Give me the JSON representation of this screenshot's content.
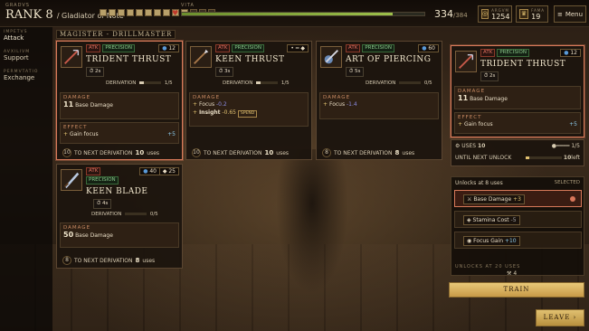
{
  "topbar": {
    "rank_label_small": "GRADVS",
    "rank_label": "RANK 8",
    "rank_title": "/ Gladiator of Note",
    "rank_pips": [
      true,
      true,
      true,
      true,
      true,
      true,
      true,
      true,
      true,
      true,
      false,
      false,
      false
    ],
    "vita_label": "VITA",
    "vita_value": "334",
    "vita_max": "/384",
    "vita_fraction": 0.87,
    "argentum_label": "ARGVM",
    "argentum_value": "1254",
    "fama_label": "FAMA",
    "fama_value": "19",
    "menu_label": "Menu"
  },
  "leftnav": {
    "items": [
      {
        "small": "IMPETVS",
        "label": "Attack"
      },
      {
        "small": "AVXILIVM",
        "label": "Support"
      },
      {
        "small": "PERMVTATIO",
        "label": "Exchange"
      }
    ]
  },
  "group_label": "MAGISTER - DRILLMASTER",
  "cards": [
    {
      "tags": [
        "ATK",
        "PRECISION"
      ],
      "badge": "12",
      "title": "TRIDENT THRUST",
      "cooldown": "2s",
      "derivation_label": "DERIVATION",
      "derivation_value": "1/5",
      "derivation_fraction": 0.2,
      "damage_title": "DAMAGE",
      "damage_amount": "11",
      "damage_text": "Base Damage",
      "effect_title": "EFFECT",
      "effect_text": "Gain focus",
      "effect_value": "+5",
      "footer_num": "10",
      "footer_text": "TO NEXT DERIVATION",
      "footer_value": "10",
      "footer_unit": "uses"
    },
    {
      "tags": [
        "ATK",
        "PRECISION"
      ],
      "badge": "",
      "title": "KEEN THRUST",
      "cooldown": "3s",
      "derivation_label": "DERIVATION",
      "derivation_value": "1/5",
      "derivation_fraction": 0.2,
      "damage_title": "DAMAGE",
      "line1_label": "Focus",
      "line1_value": "-0.2",
      "line2_label": "Insight",
      "line2_value": "-0.65",
      "line2_tag": "SPEND",
      "footer_num": "10",
      "footer_text": "TO NEXT DERIVATION",
      "footer_value": "10",
      "footer_unit": "uses"
    },
    {
      "tags": [
        "ATK",
        "PRECISION"
      ],
      "badge": "60",
      "title": "ART OF PIERCING",
      "cooldown": "5s",
      "derivation_label": "DERIVATION",
      "derivation_value": "0/5",
      "derivation_fraction": 0,
      "damage_title": "DAMAGE",
      "line1_label": "Focus",
      "line1_value": "-1.4",
      "footer_num": "8",
      "footer_text": "TO NEXT DERIVATION",
      "footer_value": "8",
      "footer_unit": "uses"
    },
    {
      "tags": [
        "ATK",
        "PRECISION"
      ],
      "badge": "40",
      "badge2": "25",
      "title": "KEEN BLADE",
      "cooldown": "4s",
      "derivation_label": "DERIVATION",
      "derivation_value": "0/5",
      "derivation_fraction": 0,
      "damage_title": "DAMAGE",
      "damage_amount": "50",
      "damage_text": "Base Damage",
      "footer_num": "8",
      "footer_text": "TO NEXT DERIVATION",
      "footer_value": "8",
      "footer_unit": "uses"
    }
  ],
  "detail": {
    "tags": [
      "ATK",
      "PRECISION"
    ],
    "badge": "12",
    "title": "TRIDENT THRUST",
    "cooldown": "2s",
    "damage_title": "DAMAGE",
    "damage_amount": "11",
    "damage_text": "Base Damage",
    "effect_title": "EFFECT",
    "effect_text": "Gain focus",
    "effect_value": "+5",
    "uses_label": "USES",
    "uses_value": "10",
    "deriv_value": "1/5",
    "until_label": "UNTIL NEXT UNLOCK",
    "until_value": "10",
    "until_unit": "left",
    "until_fraction": 0.1
  },
  "unlocks": {
    "title": "Unlocks at 8 uses",
    "selected_label": "SELECTED",
    "items": [
      {
        "label": "Base Damage",
        "value": "+3"
      },
      {
        "label": "Stamina Cost",
        "value": "-5"
      },
      {
        "label": "Focus Gain",
        "value": "+10"
      }
    ],
    "next_label": "UNLOCKS AT 20 USES"
  },
  "train": {
    "count": "4",
    "label": "TRAIN"
  },
  "leave_label": "LEAVE ›"
}
